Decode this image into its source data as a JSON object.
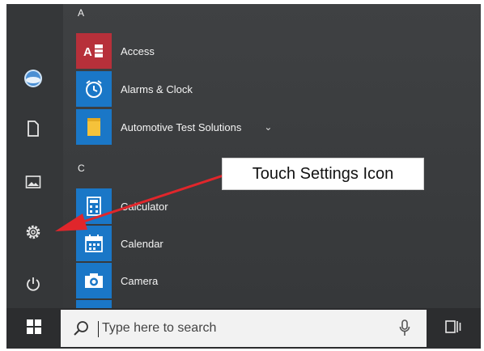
{
  "start_menu": {
    "sections": {
      "a": "A",
      "c": "C"
    },
    "apps": {
      "access": {
        "label": "Access",
        "tile_text": "A",
        "tile_color": "#b7303a"
      },
      "alarms": {
        "label": "Alarms & Clock",
        "tile_color": "#1a77c7"
      },
      "automotive": {
        "label": "Automotive Test Solutions",
        "tile_color": "#1a77c7",
        "expand": "⌄"
      },
      "calculator": {
        "label": "Calculator",
        "tile_color": "#1a77c7"
      },
      "calendar": {
        "label": "Calendar",
        "tile_color": "#1a77c7"
      },
      "camera": {
        "label": "Camera",
        "tile_color": "#1a77c7"
      }
    },
    "rail": [
      "avatar-icon",
      "document-icon",
      "pictures-icon",
      "settings-icon",
      "power-icon"
    ]
  },
  "annotation": {
    "callout": "Touch Settings Icon",
    "arrow_color": "#e0262b"
  },
  "taskbar": {
    "search_placeholder": "Type here to search",
    "start_icon": "windows-logo-icon",
    "mic_icon": "microphone-icon",
    "task_view_icon": "task-view-icon"
  }
}
